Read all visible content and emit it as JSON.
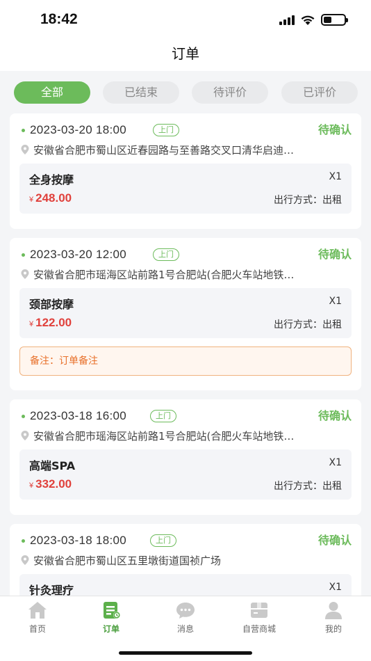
{
  "status_bar": {
    "time": "18:42"
  },
  "nav": {
    "title": "订单"
  },
  "filters": [
    "全部",
    "已结束",
    "待评价",
    "已评价"
  ],
  "orders": [
    {
      "time": "2023-03-20 18:00",
      "tag": "上门",
      "status": "待确认",
      "address": "安徽省合肥市蜀山区近春园路与至善路交叉口清华启迪…",
      "service": "全身按摩",
      "qty": "X1",
      "currency": "¥",
      "price": "248.00",
      "travel": "出行方式：出租"
    },
    {
      "time": "2023-03-20 12:00",
      "tag": "上门",
      "status": "待确认",
      "address": "安徽省合肥市瑶海区站前路1号合肥站(合肥火车站地铁…",
      "service": "颈部按摩",
      "qty": "X1",
      "currency": "¥",
      "price": "122.00",
      "travel": "出行方式：出租",
      "note": "备注：订单备注"
    },
    {
      "time": "2023-03-18 16:00",
      "tag": "上门",
      "status": "待确认",
      "address": "安徽省合肥市瑶海区站前路1号合肥站(合肥火车站地铁…",
      "service": "高端SPA",
      "qty": "X1",
      "currency": "¥",
      "price": "332.00",
      "travel": "出行方式：出租"
    },
    {
      "time": "2023-03-18 18:00",
      "tag": "上门",
      "status": "待确认",
      "address": "安徽省合肥市蜀山区五里墩街道国祯广场",
      "service": "针灸理疗",
      "qty": "X1"
    }
  ],
  "tab_bar": [
    {
      "label": "首页",
      "icon": "home-icon"
    },
    {
      "label": "订单",
      "icon": "order-icon"
    },
    {
      "label": "消息",
      "icon": "message-icon"
    },
    {
      "label": "自营商城",
      "icon": "store-icon"
    },
    {
      "label": "我的",
      "icon": "user-icon"
    }
  ],
  "colors": {
    "accent": "#6cbb5b",
    "price": "#e0413c",
    "note": "#e8702a"
  }
}
